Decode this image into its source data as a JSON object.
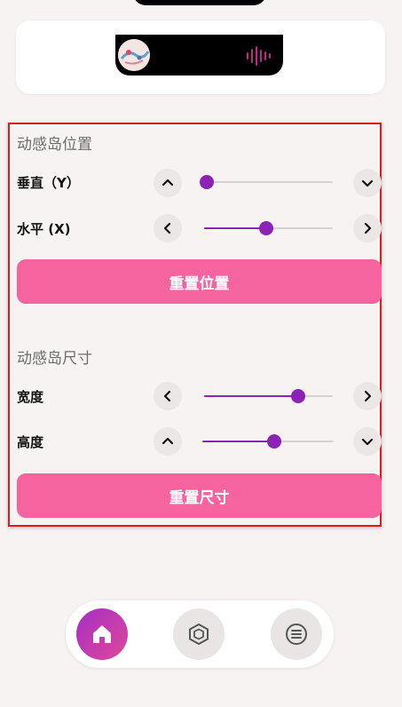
{
  "position_section": {
    "title": "动感岛位置",
    "vertical": {
      "label": "垂直（Y）",
      "value_fraction": 0.0
    },
    "horizontal": {
      "label": "水平 (X)",
      "value_fraction": 0.48
    },
    "reset_label": "重置位置"
  },
  "size_section": {
    "title": "动感岛尺寸",
    "width": {
      "label": "宽度",
      "value_fraction": 0.73
    },
    "height": {
      "label": "高度",
      "value_fraction": 0.55
    },
    "reset_label": "重置尺寸"
  },
  "colors": {
    "accent": "#8c22b6",
    "reset_button": "#f6649f",
    "highlight_border": "#d81f1f",
    "wave": "#c2268f"
  },
  "icons": {
    "preview_avatar": "avatar",
    "preview_wave": "sound-wave-icon",
    "nav_home": "home-icon",
    "nav_cube": "cube-icon",
    "nav_menu": "menu-icon"
  }
}
